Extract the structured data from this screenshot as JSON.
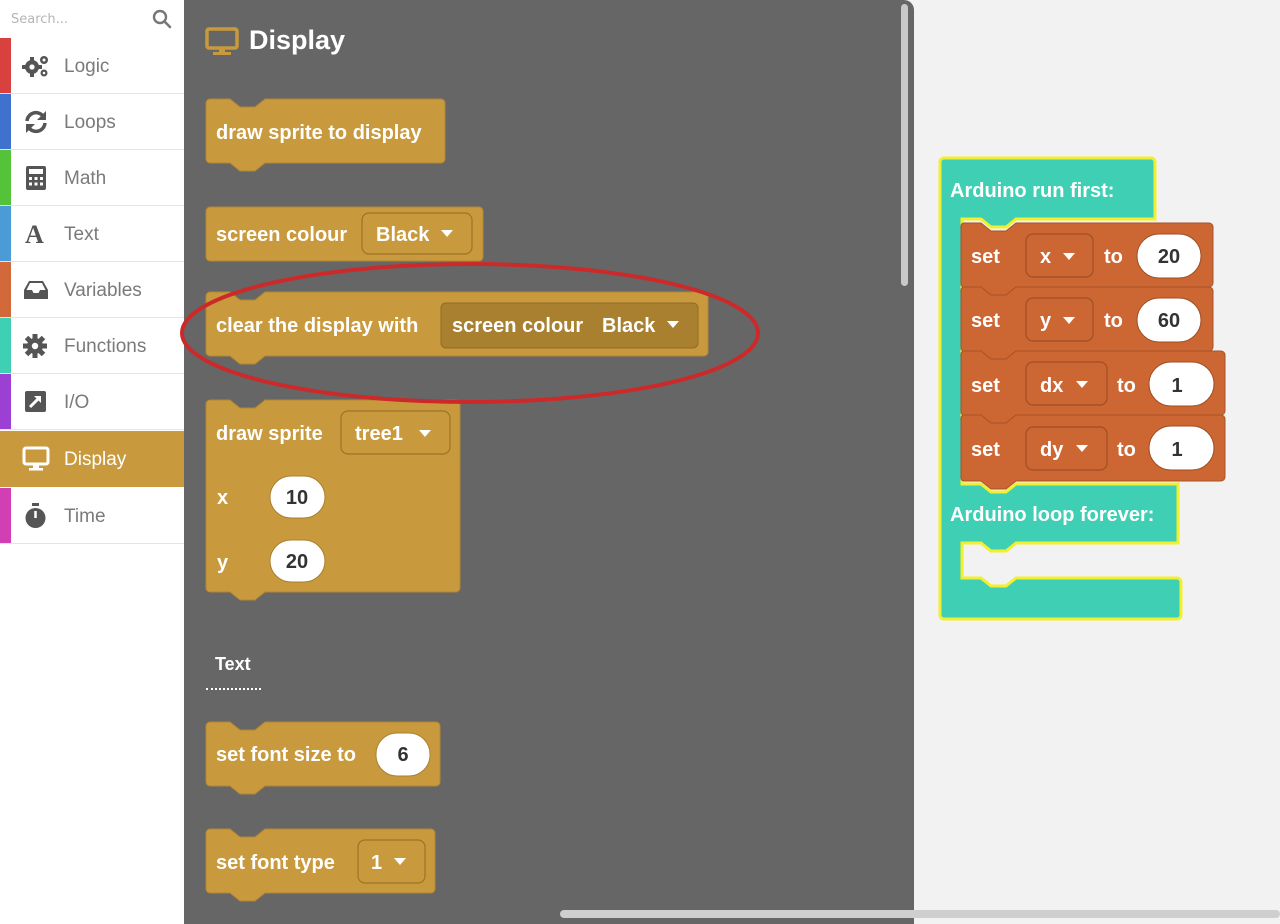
{
  "search": {
    "placeholder": "Search..."
  },
  "categories": [
    {
      "label": "Logic",
      "icon": "gears-icon",
      "color": "#d9413e"
    },
    {
      "label": "Loops",
      "icon": "refresh-icon",
      "color": "#3f72cf"
    },
    {
      "label": "Math",
      "icon": "calculator-icon",
      "color": "#55c33a"
    },
    {
      "label": "Text",
      "icon": "letter-a-icon",
      "color": "#4a9bd6"
    },
    {
      "label": "Variables",
      "icon": "inbox-icon",
      "color": "#d2693b"
    },
    {
      "label": "Functions",
      "icon": "gear-icon",
      "color": "#3fcfb4"
    },
    {
      "label": "I/O",
      "icon": "arrow-box-icon",
      "color": "#9c3fd3"
    },
    {
      "label": "Display",
      "icon": "monitor-icon",
      "color": "#c99a3d"
    },
    {
      "label": "Time",
      "icon": "stopwatch-icon",
      "color": "#d23fb4"
    }
  ],
  "selected_category": "Display",
  "flyout": {
    "title": "Display",
    "title_icon": "monitor-icon",
    "block_color": "#c99a3d",
    "blocks": {
      "draw_sprite_to_display": "draw sprite to display",
      "screen_colour": {
        "label": "screen colour",
        "value": "Black"
      },
      "clear_display": {
        "label": "clear the display with",
        "inner_label": "screen colour",
        "inner_value": "Black"
      },
      "draw_sprite": {
        "label": "draw sprite",
        "sprite": "tree1",
        "x_label": "x",
        "x_value": "10",
        "y_label": "y",
        "y_value": "20"
      }
    },
    "text_section": "Text",
    "text_blocks": {
      "set_font_size": {
        "label": "set font size to",
        "value": "6"
      },
      "set_font_type": {
        "label": "set font type",
        "value": "1"
      }
    }
  },
  "highlight": {
    "color": "#cc2a2a",
    "target": "clear the display with"
  },
  "workspace": {
    "main_color": "#3fcfb4",
    "outline_color": "#f2ef2c",
    "var_block_color": "#cc6633",
    "run_first": "Arduino run first:",
    "loop_forever": "Arduino loop forever:",
    "set_blocks": [
      {
        "set": "set",
        "var": "x",
        "to": "to",
        "value": "20"
      },
      {
        "set": "set",
        "var": "y",
        "to": "to",
        "value": "60"
      },
      {
        "set": "set",
        "var": "dx",
        "to": "to",
        "value": "1"
      },
      {
        "set": "set",
        "var": "dy",
        "to": "to",
        "value": "1"
      }
    ]
  }
}
